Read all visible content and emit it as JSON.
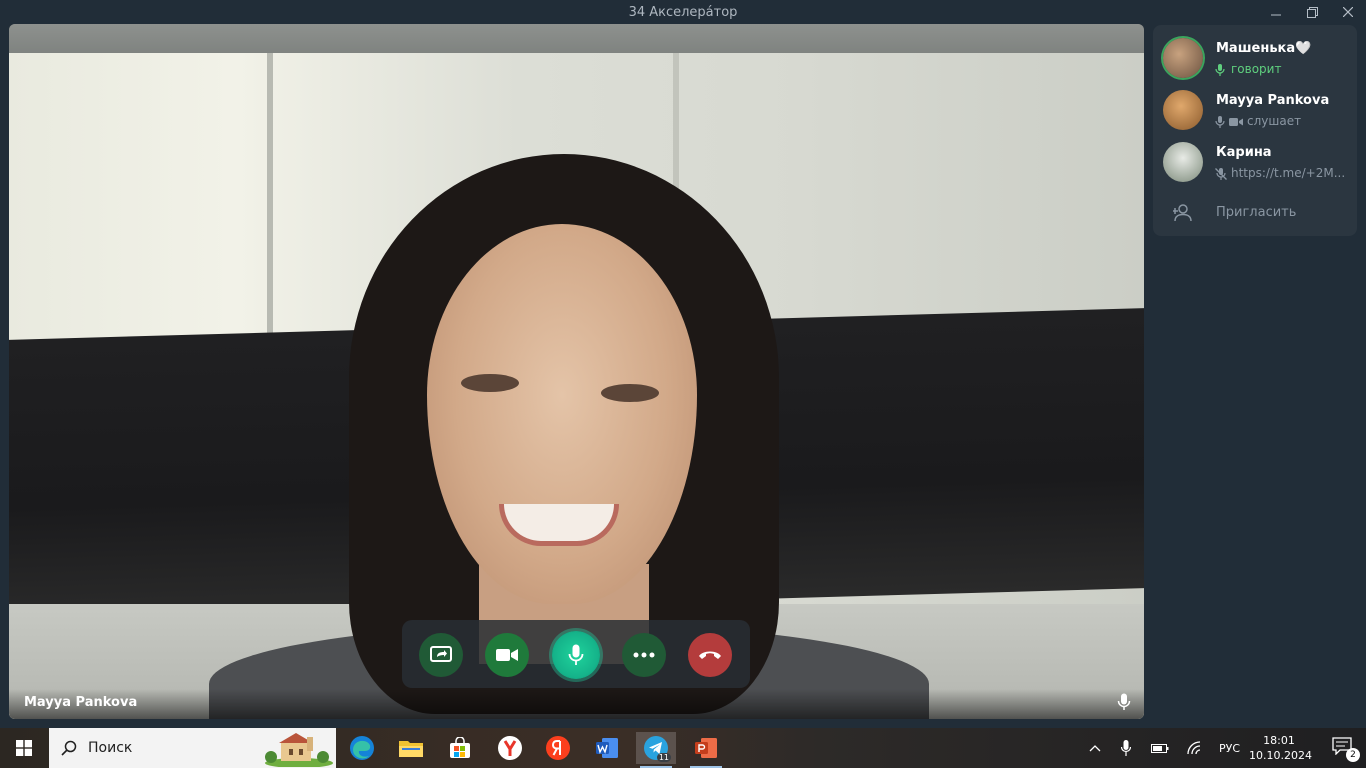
{
  "window": {
    "title": "34 Акселера́тор"
  },
  "video": {
    "speaker_name": "Mayya Pankova"
  },
  "controls": {
    "screen_share_icon": "screen-share-icon",
    "camera_icon": "camera-icon",
    "mic_icon": "microphone-icon",
    "more_icon": "more-dots-icon",
    "end_icon": "end-call-icon"
  },
  "participants": [
    {
      "name": "Машенька🤍",
      "status": "говорит",
      "state": "speaking"
    },
    {
      "name": "Mayya Pankova",
      "status": "слушает",
      "state": "listening"
    },
    {
      "name": "Карина",
      "status": "https://t.me/+2M...",
      "state": "muted"
    }
  ],
  "invite": {
    "label": "Пригласить"
  },
  "taskbar": {
    "search_placeholder": "Поиск",
    "telegram_badge": "11",
    "language": "РУС",
    "time": "18:01",
    "date": "10.10.2024",
    "notifications": "2"
  },
  "colors": {
    "accent_green": "#3ba55d",
    "end_call_red": "#b43c3c",
    "sidebar_bg": "#2b3640"
  }
}
